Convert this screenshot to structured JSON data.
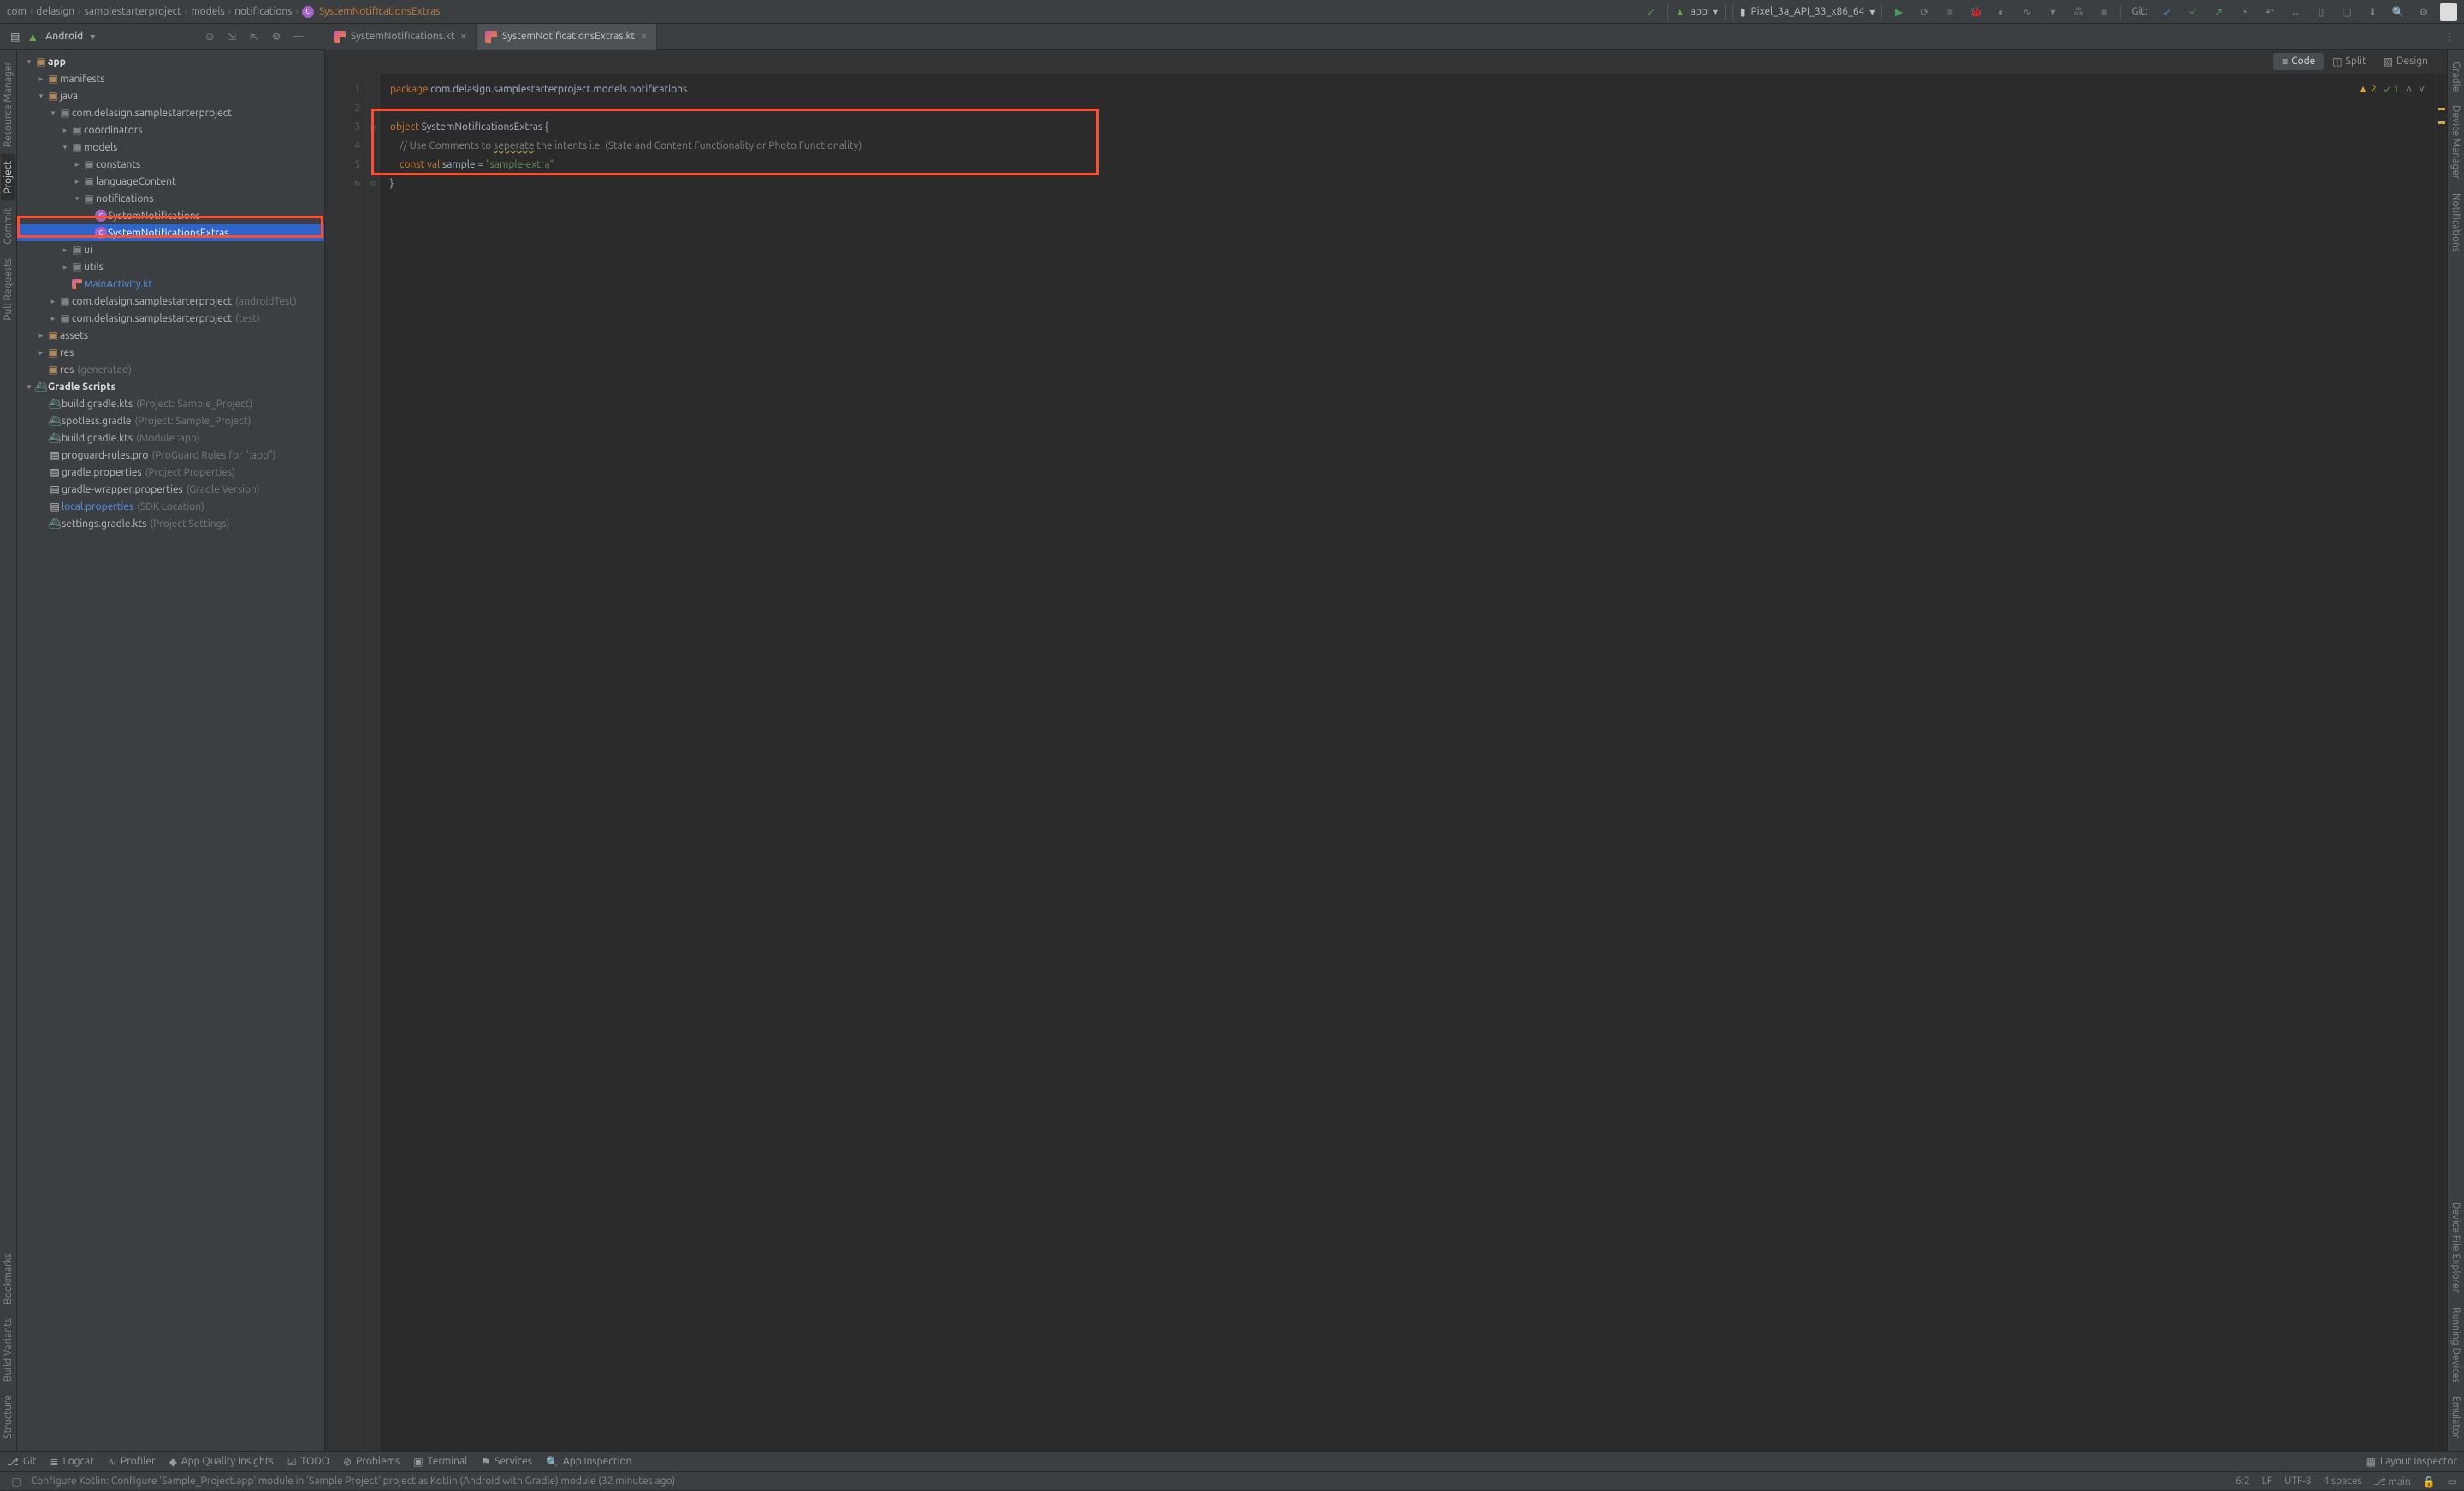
{
  "breadcrumbs": [
    "com",
    "delasign",
    "samplestarterproject",
    "models",
    "notifications",
    "SystemNotificationsExtras"
  ],
  "toolbar": {
    "run_config": "app",
    "device": "Pixel_3a_API_33_x86_64",
    "git_label": "Git:"
  },
  "project": {
    "selector": "Android"
  },
  "editor_tabs": [
    {
      "name": "SystemNotifications.kt",
      "active": false
    },
    {
      "name": "SystemNotificationsExtras.kt",
      "active": true
    }
  ],
  "view_modes": {
    "code": "Code",
    "split": "Split",
    "design": "Design"
  },
  "tree": {
    "app": "app",
    "manifests": "manifests",
    "java": "java",
    "pkg": "com.delasign.samplestarterproject",
    "coordinators": "coordinators",
    "models": "models",
    "constants": "constants",
    "languageContent": "languageContent",
    "notifications": "notifications",
    "sys_notif": "SystemNotifications",
    "sys_notif_extras": "SystemNotificationsExtras",
    "ui": "ui",
    "utils": "utils",
    "main_activity": "MainActivity.kt",
    "pkg_android_test": "com.delasign.samplestarterproject",
    "pkg_android_test_suffix": "(androidTest)",
    "pkg_test": "com.delasign.samplestarterproject",
    "pkg_test_suffix": "(test)",
    "assets": "assets",
    "res": "res",
    "res_gen": "res",
    "res_gen_suffix": "(generated)",
    "gradle_scripts": "Gradle Scripts",
    "build_gradle_proj": "build.gradle.kts",
    "build_gradle_proj_suffix": "(Project: Sample_Project)",
    "spotless": "spotless.gradle",
    "spotless_suffix": "(Project: Sample_Project)",
    "build_gradle_app": "build.gradle.kts",
    "build_gradle_app_suffix": "(Module :app)",
    "proguard": "proguard-rules.pro",
    "proguard_suffix": "(ProGuard Rules for \":app\")",
    "gradle_props": "gradle.properties",
    "gradle_props_suffix": "(Project Properties)",
    "wrapper": "gradle-wrapper.properties",
    "wrapper_suffix": "(Gradle Version)",
    "local_props": "local.properties",
    "local_props_suffix": "(SDK Location)",
    "settings": "settings.gradle.kts",
    "settings_suffix": "(Project Settings)"
  },
  "code": {
    "package_kw": "package",
    "package_name": "com.delasign.samplestarterproject.models.notifications",
    "object_kw": "object",
    "class_name": "SystemNotificationsExtras",
    "comment": "// Use Comments to ",
    "comment_warn": "seperate",
    "comment_rest": " the intents i.e. (State and Content Functionality or Photo Functionality)",
    "const_kw": "const",
    "val_kw": "val",
    "field": "sample",
    "eq": "=",
    "string": "\"sample-extra\""
  },
  "inspections": {
    "warnings": "2",
    "oks": "1"
  },
  "left_rail": {
    "resource_manager": "Resource Manager",
    "project": "Project",
    "commit": "Commit",
    "pull_requests": "Pull Requests",
    "bookmarks": "Bookmarks",
    "build_variants": "Build Variants",
    "structure": "Structure"
  },
  "right_rail": {
    "gradle": "Gradle",
    "device_manager": "Device Manager",
    "notifications": "Notifications",
    "device_file_explorer": "Device File Explorer",
    "running_devices": "Running Devices",
    "emulator": "Emulator"
  },
  "bottom_tools": {
    "git": "Git",
    "logcat": "Logcat",
    "profiler": "Profiler",
    "app_quality": "App Quality Insights",
    "todo": "TODO",
    "problems": "Problems",
    "terminal": "Terminal",
    "services": "Services",
    "app_inspection": "App Inspection",
    "layout_inspector": "Layout Inspector"
  },
  "status": {
    "message": "Configure Kotlin: Configure 'Sample_Project.app' module in 'Sample Project' project as Kotlin (Android with Gradle) module (32 minutes ago)",
    "pos": "6:2",
    "line_sep": "LF",
    "encoding": "UTF-8",
    "indent": "4 spaces",
    "branch": "main"
  }
}
